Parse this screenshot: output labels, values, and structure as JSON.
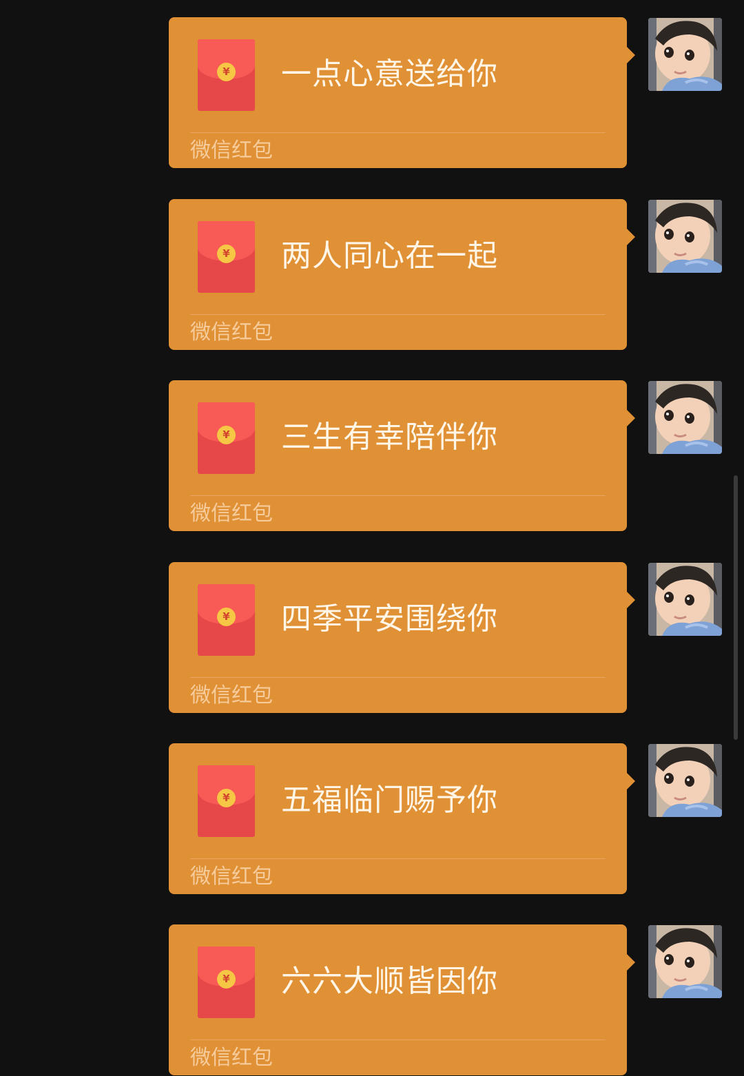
{
  "chat": {
    "messages": [
      {
        "greeting": "一点心意送给你",
        "label": "微信红包"
      },
      {
        "greeting": "两人同心在一起",
        "label": "微信红包"
      },
      {
        "greeting": "三生有幸陪伴你",
        "label": "微信红包"
      },
      {
        "greeting": "四季平安围绕你",
        "label": "微信红包"
      },
      {
        "greeting": "五福临门赐予你",
        "label": "微信红包"
      },
      {
        "greeting": "六六大顺皆因你",
        "label": "微信红包"
      }
    ],
    "envelope_symbol": "¥",
    "avatar_icon": "child-photo-avatar"
  },
  "colors": {
    "background": "#111111",
    "bubble": "#e09035",
    "envelope": "#e6484a",
    "envelope_flap": "#f85a56",
    "coin": "#f6c744"
  }
}
